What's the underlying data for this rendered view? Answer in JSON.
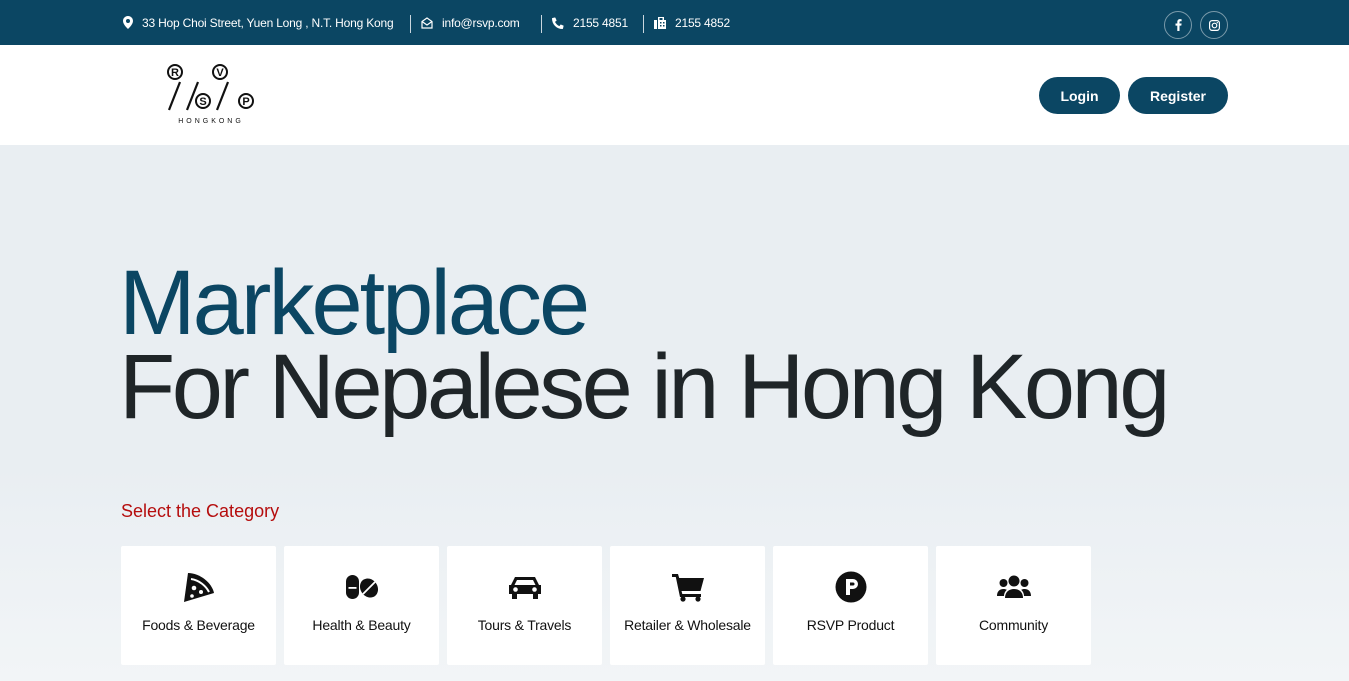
{
  "topbar": {
    "address": "33 Hop Choi Street, Yuen Long , N.T. Hong Kong",
    "email": "info@rsvp.com",
    "phone": "2155 4851",
    "fax": "2155 4852"
  },
  "header": {
    "logo_text": "RSVP HONG KONG",
    "logo_sub": "HONGKONG",
    "login_label": "Login",
    "register_label": "Register"
  },
  "hero": {
    "title_line1": "Marketplace",
    "title_line2": "For Nepalese in Hong Kong",
    "select_label": "Select the Category"
  },
  "categories": [
    {
      "label": "Foods & Beverage",
      "icon": "pizza-icon"
    },
    {
      "label": "Health & Beauty",
      "icon": "pills-icon"
    },
    {
      "label": "Tours & Travels",
      "icon": "car-icon"
    },
    {
      "label": "Retailer & Wholesale",
      "icon": "cart-icon"
    },
    {
      "label": "RSVP Product",
      "icon": "parking-p-icon"
    },
    {
      "label": "Community",
      "icon": "users-icon"
    }
  ],
  "colors": {
    "brand": "#0b4663",
    "accent_red": "#b50d0d",
    "hero_bg": "#e9eef2"
  }
}
